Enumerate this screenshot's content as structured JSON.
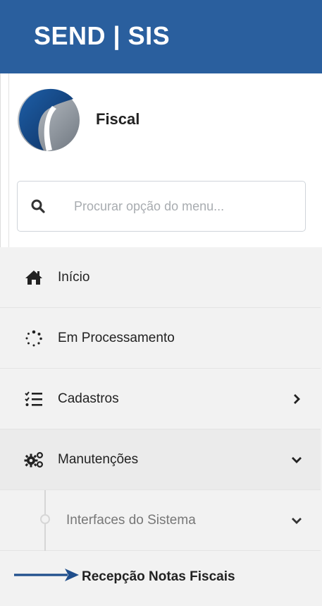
{
  "header": {
    "brand": "SEND | SIS"
  },
  "profile": {
    "module_name": "Fiscal"
  },
  "search": {
    "placeholder": "Procurar opção do menu..."
  },
  "menu": {
    "items": [
      {
        "label": "Início",
        "icon": "home-icon"
      },
      {
        "label": "Em Processamento",
        "icon": "spinner-icon"
      },
      {
        "label": "Cadastros",
        "icon": "checklist-icon",
        "chevron": "chevron-right-icon"
      },
      {
        "label": "Manutenções",
        "icon": "gears-icon",
        "chevron": "chevron-down-icon"
      }
    ],
    "submenu": {
      "label": "Interfaces do Sistema",
      "chevron": "chevron-down-icon",
      "child": {
        "label": "Recepção Notas Fiscais",
        "pointer": "arrow-right-icon"
      }
    }
  },
  "colors": {
    "header_bg": "#2a5f9e",
    "menu_bg": "#f2f2f2",
    "arrow": "#1f4e8c"
  }
}
